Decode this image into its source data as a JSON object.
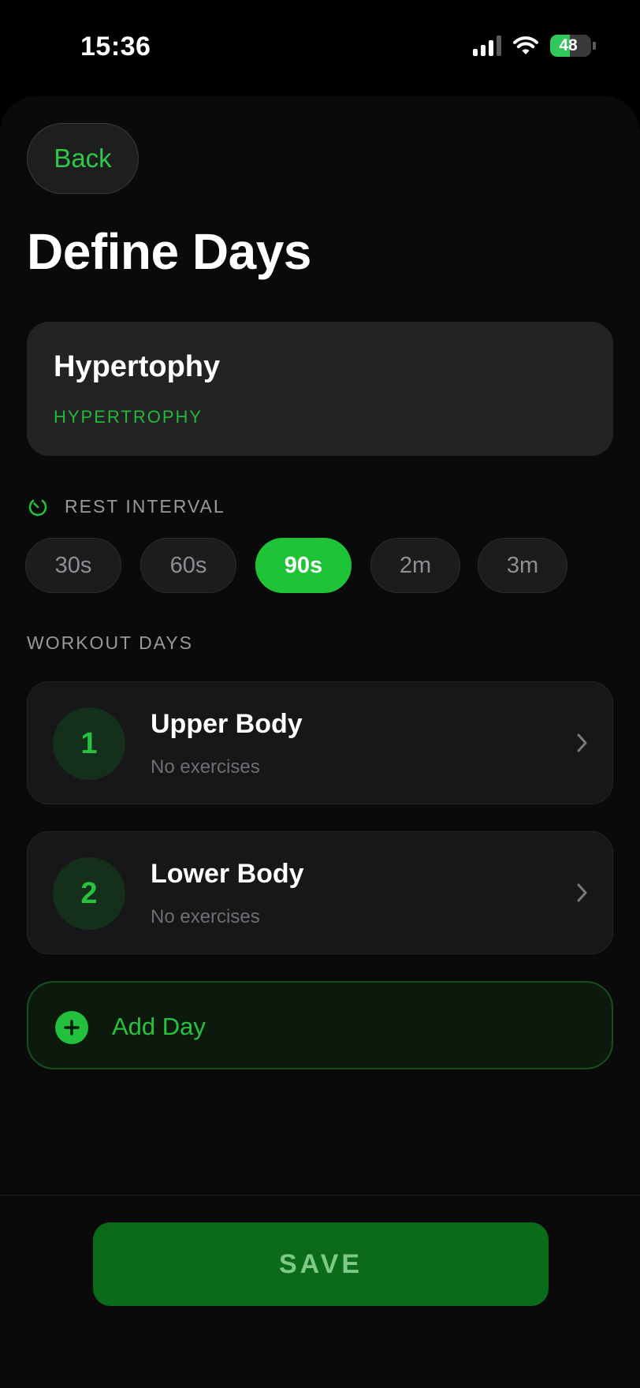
{
  "status_bar": {
    "time": "15:36",
    "battery_percent": "48",
    "battery_level": 0.48,
    "signal_bars_filled": 3,
    "icons": [
      "cellular-signal-icon",
      "wifi-icon",
      "battery-charging-icon"
    ]
  },
  "header": {
    "back_label": "Back",
    "title": "Define Days"
  },
  "program": {
    "name": "Hypertophy",
    "type": "HYPERTROPHY"
  },
  "rest_interval": {
    "label": "REST INTERVAL",
    "options": [
      "30s",
      "60s",
      "90s",
      "2m",
      "3m"
    ],
    "selected": "90s"
  },
  "workout_days": {
    "label": "WORKOUT DAYS",
    "days": [
      {
        "number": "1",
        "name": "Upper Body",
        "subtitle": "No exercises"
      },
      {
        "number": "2",
        "name": "Lower Body",
        "subtitle": "No exercises"
      }
    ],
    "add_label": "Add Day"
  },
  "footer": {
    "save_label": "SAVE"
  },
  "colors": {
    "accent": "#1ec338",
    "background": "#0a0a0a",
    "card": "#232323",
    "save_button": "#0b6b1a"
  }
}
